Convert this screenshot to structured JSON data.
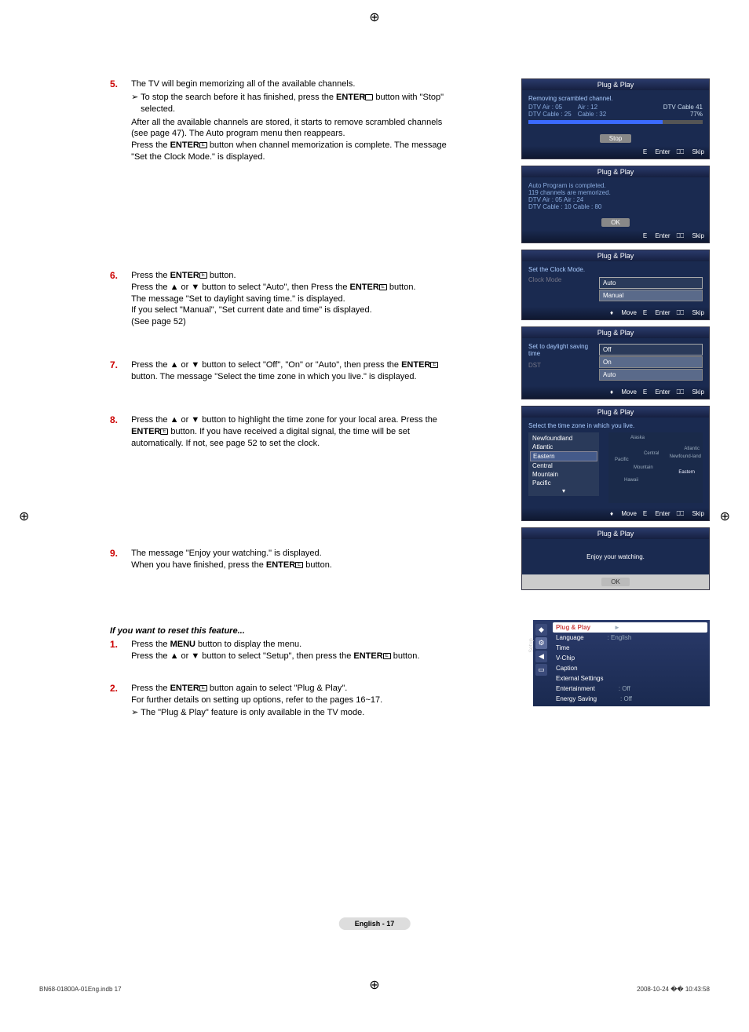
{
  "steps": {
    "s5": {
      "num": "5.",
      "line1": "The TV will begin memorizing all of the available channels.",
      "bullet1_a": "To stop the search before it has finished, press the ",
      "bullet1_b": "ENTER",
      "bullet1_c": " button with \"Stop\" selected.",
      "after1": "After all the available channels are stored, it starts to remove scrambled channels (see page 47). The Auto program menu then reappears.",
      "after2a": "Press the ",
      "after2b": "ENTER",
      "after2c": " button when channel memorization is complete. The message \"Set the Clock Mode.\" is displayed."
    },
    "s6": {
      "num": "6.",
      "l1a": "Press the ",
      "l1b": "ENTER",
      "l1c": " button.",
      "l2a": "Press the ▲ or ▼ button to select \"Auto\", then Press the ",
      "l2b": "ENTER",
      "l2c": " button.",
      "l3": "The message \"Set to daylight saving time.\" is displayed.",
      "l4": "If you select \"Manual\", \"Set current date and time\" is displayed.",
      "l5": "(See page 52)"
    },
    "s7": {
      "num": "7.",
      "l1a": "Press the ▲ or ▼ button to select \"Off\", \"On\" or \"Auto\", then press the ",
      "l1b": "ENTER",
      "l1c": " button. The message \"Select the time zone in which you live.\" is displayed."
    },
    "s8": {
      "num": "8.",
      "l1a": "Press the ▲ or ▼ button to highlight the time zone for your local area. Press the ",
      "l1b": "ENTER",
      "l1c": " button. If you have received a digital signal, the time will be set automatically. If not, see page 52 to set the clock."
    },
    "s9": {
      "num": "9.",
      "l1": "The message \"Enjoy your watching.\" is displayed.",
      "l2a": "When you have finished, press the ",
      "l2b": "ENTER",
      "l2c": " button."
    }
  },
  "reset": {
    "heading": "If you want to reset this feature...",
    "s1": {
      "num": "1.",
      "l1a": "Press the ",
      "l1b": "MENU",
      "l1c": " button to display the menu.",
      "l2a": "Press the ▲ or ▼ button to select \"Setup\", then press the ",
      "l2b": "ENTER",
      "l2c": " button."
    },
    "s2": {
      "num": "2.",
      "l1a": "Press the ",
      "l1b": "ENTER",
      "l1c": " button again to select \"Plug & Play\".",
      "l2": "For further details on setting up options, refer to the pages 16~17.",
      "bullet": "The \"Plug & Play\" feature is only available in the TV mode."
    }
  },
  "ui": {
    "title": "Plug & Play",
    "panel1": {
      "removing": "Removing scrambled channel.",
      "dtv_air": "DTV Air : 05",
      "air": "Air : 12",
      "dtv_cable": "DTV Cable : 25",
      "cable": "Cable : 32",
      "dtv_cable41": "DTV Cable 41",
      "pct": "77%",
      "stop": "Stop"
    },
    "footer_enter": "Enter",
    "footer_skip": "Skip",
    "footer_move": "Move",
    "panel2": {
      "l1": "Auto Program is completed.",
      "l2": "119 channels are memorized.",
      "l3": "DTV Air : 05    Air : 24",
      "l4": "DTV Cable : 10    Cable : 80",
      "ok": "OK"
    },
    "panel3": {
      "head": "Set the Clock Mode.",
      "label": "Clock Mode",
      "opt1": "Auto",
      "opt2": "Manual"
    },
    "panel4": {
      "head": "Set to daylight saving time",
      "label": "DST",
      "opt1": "Off",
      "opt2": "On",
      "opt3": "Auto"
    },
    "panel5": {
      "head": "Select the time zone in which you live.",
      "tz": [
        "Newfoundland",
        "Atlantic",
        "Eastern",
        "Central",
        "Mountain",
        "Pacific"
      ],
      "map_labels": [
        "Alaska",
        "Atlantic",
        "Central",
        "Newfound-land",
        "Pacific",
        "Mountain",
        "Eastern",
        "Hawaii"
      ]
    },
    "panel6": {
      "msg": "Enjoy your watching.",
      "ok": "OK"
    }
  },
  "setup_menu": {
    "tab": "Setup",
    "rows": [
      {
        "k": "Plug & Play",
        "v": "►",
        "hl": true
      },
      {
        "k": "Language",
        "v": ": English"
      },
      {
        "k": "Time",
        "v": ""
      },
      {
        "k": "V-Chip",
        "v": ""
      },
      {
        "k": "Caption",
        "v": ""
      },
      {
        "k": "External Settings",
        "v": ""
      },
      {
        "k": "Entertainment",
        "v": ": Off"
      },
      {
        "k": "Energy Saving",
        "v": ": Off"
      }
    ]
  },
  "page_num": "English - 17",
  "footer": {
    "left": "BN68-01800A-01Eng.indb   17",
    "right": "2008-10-24   �� 10:43:58"
  },
  "icons": {
    "enter": "E",
    "move": "♦",
    "skip": "⎕⎕"
  }
}
